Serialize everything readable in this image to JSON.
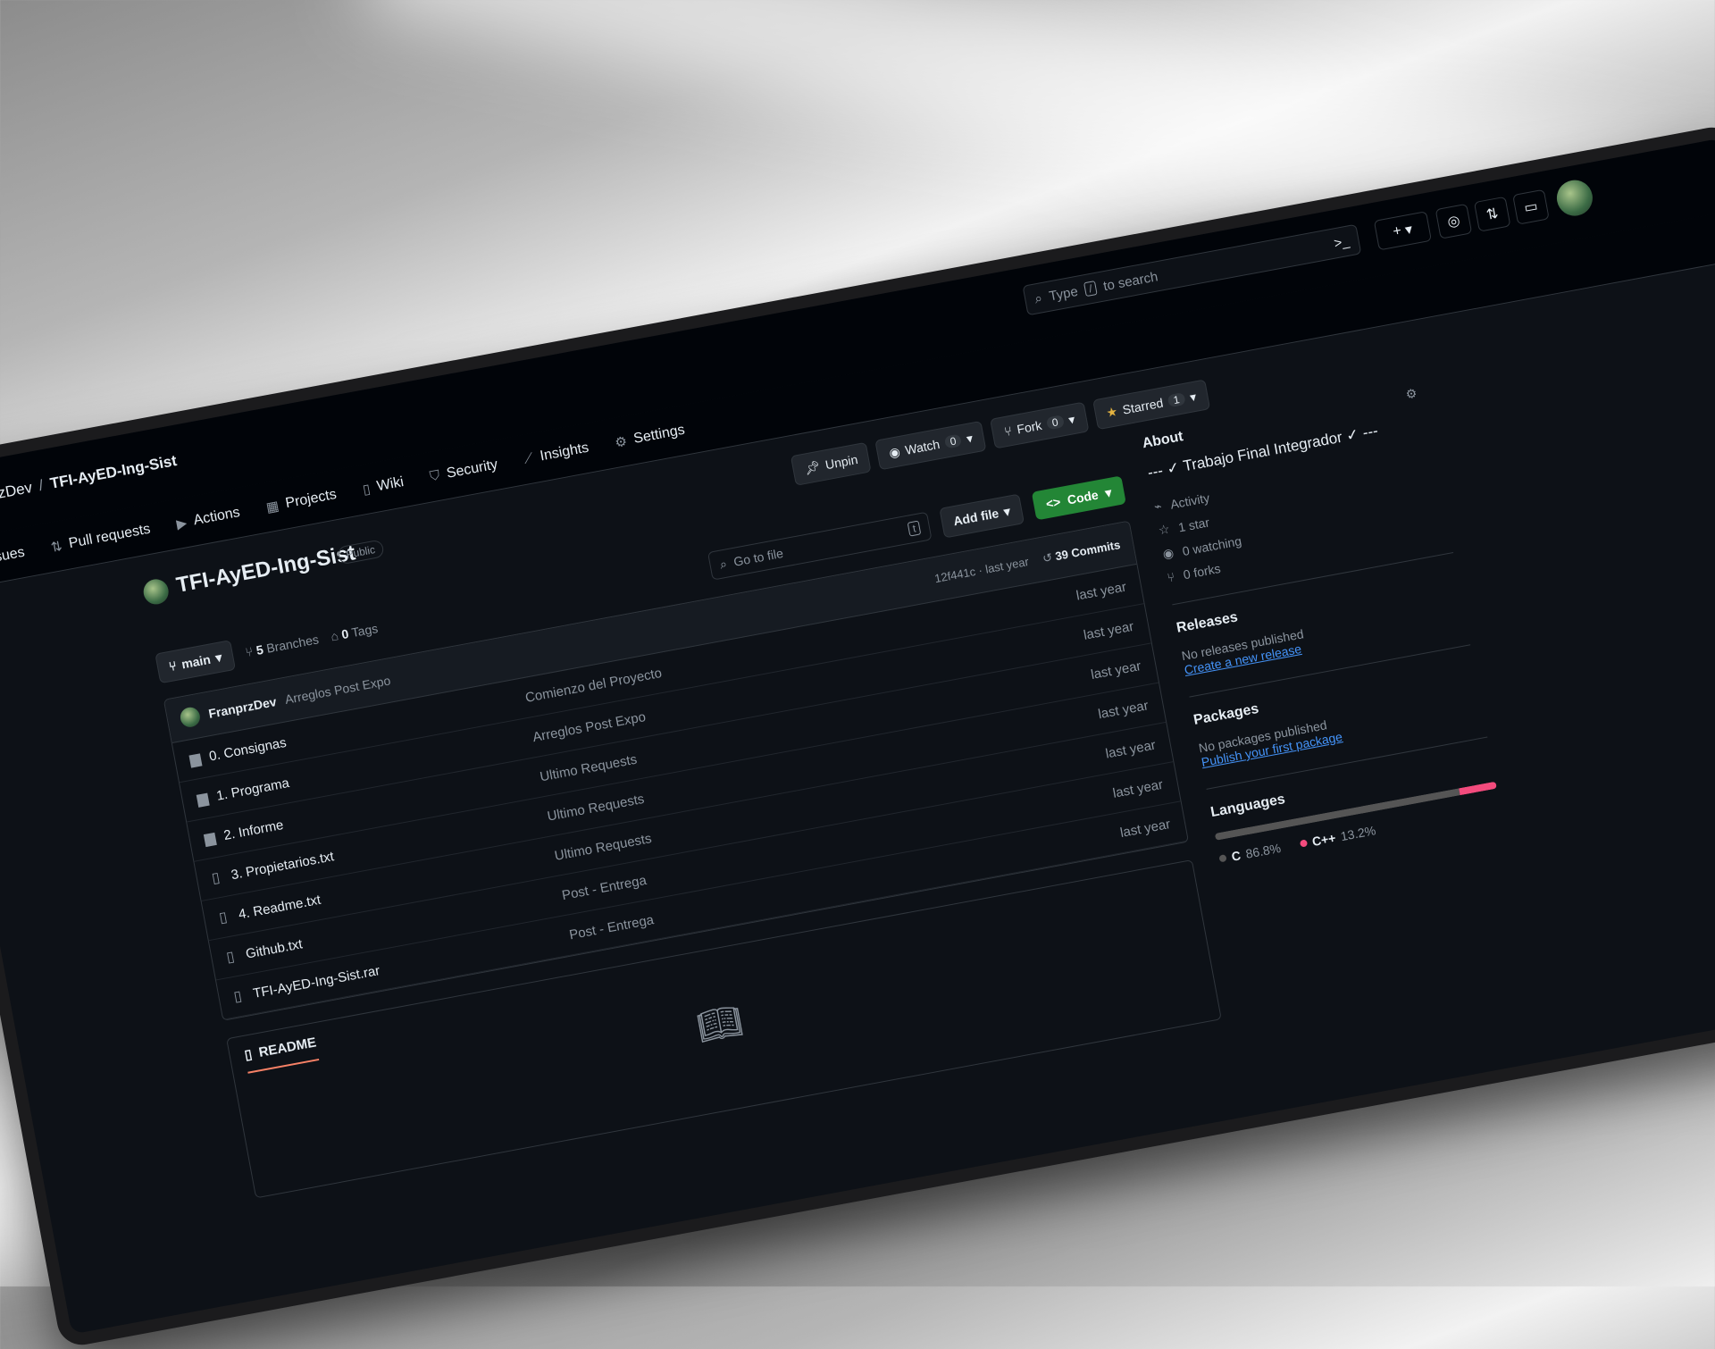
{
  "breadcrumb": {
    "owner": "FranprzDev",
    "separator": "/",
    "repo": "TFI-AyED-Ing-Sist"
  },
  "search": {
    "prefix": "Type",
    "key": "/",
    "suffix": "to search"
  },
  "header_icons": {
    "terminal": ">_",
    "plus": "+",
    "caret": "▾"
  },
  "nav": {
    "tabs": [
      {
        "label": "Issues",
        "icon": "issue-icon"
      },
      {
        "label": "Pull requests",
        "icon": "pull-request-icon"
      },
      {
        "label": "Actions",
        "icon": "actions-icon"
      },
      {
        "label": "Projects",
        "icon": "projects-icon"
      },
      {
        "label": "Wiki",
        "icon": "wiki-icon"
      },
      {
        "label": "Security",
        "icon": "shield-icon"
      },
      {
        "label": "Insights",
        "icon": "graph-icon"
      },
      {
        "label": "Settings",
        "icon": "gear-icon"
      }
    ]
  },
  "repo": {
    "name": "TFI-AyED-Ing-Sist",
    "visibility": "Public"
  },
  "repo_actions": {
    "unpin": "Unpin",
    "watch": "Watch",
    "watch_count": "0",
    "fork": "Fork",
    "fork_count": "0",
    "star": "Starred",
    "star_count": "1"
  },
  "toolbar": {
    "branch": "main",
    "branches_count": "5",
    "branches_label": "Branches",
    "tags_count": "0",
    "tags_label": "Tags",
    "goto_file": "Go to file",
    "goto_key": "t",
    "add_file": "Add file",
    "code": "Code"
  },
  "latest_commit": {
    "author": "FranprzDev",
    "message": "Arreglos Post Expo",
    "hash": "12f441c · last year",
    "commits_count": "39",
    "commits_label": "Commits"
  },
  "files": [
    {
      "type": "folder",
      "name": "0. Consignas",
      "message": "Comienzo del Proyecto",
      "date": "last year"
    },
    {
      "type": "folder",
      "name": "1. Programa",
      "message": "Arreglos Post Expo",
      "date": "last year"
    },
    {
      "type": "folder",
      "name": "2. Informe",
      "message": "Ultimo Requests",
      "date": "last year"
    },
    {
      "type": "file",
      "name": "3. Propietarios.txt",
      "message": "Ultimo Requests",
      "date": "last year"
    },
    {
      "type": "file",
      "name": "4. Readme.txt",
      "message": "Ultimo Requests",
      "date": "last year"
    },
    {
      "type": "file",
      "name": "Github.txt",
      "message": "Post - Entrega",
      "date": "last year"
    },
    {
      "type": "file",
      "name": "TFI-AyED-Ing-Sist.rar",
      "message": "Post - Entrega",
      "date": "last year"
    }
  ],
  "readme": {
    "tab": "README"
  },
  "about": {
    "title": "About",
    "description": "--- ✓ Trabajo Final Integrador ✓ ---",
    "activity": "Activity",
    "stars": "1 star",
    "watching": "0 watching",
    "forks": "0 forks"
  },
  "releases": {
    "title": "Releases",
    "empty": "No releases published",
    "link": "Create a new release"
  },
  "packages": {
    "title": "Packages",
    "empty": "No packages published",
    "link": "Publish your first package"
  },
  "languages": {
    "title": "Languages",
    "items": [
      {
        "name": "C",
        "percent": "86.8%",
        "value": 86.8,
        "color": "#555555"
      },
      {
        "name": "C++",
        "percent": "13.2%",
        "value": 13.2,
        "color": "#f34b7d"
      }
    ]
  },
  "colors": {
    "accent_green": "#238636",
    "link_blue": "#4493f8",
    "star_yellow": "#e3b341",
    "underline_orange": "#f78166"
  }
}
